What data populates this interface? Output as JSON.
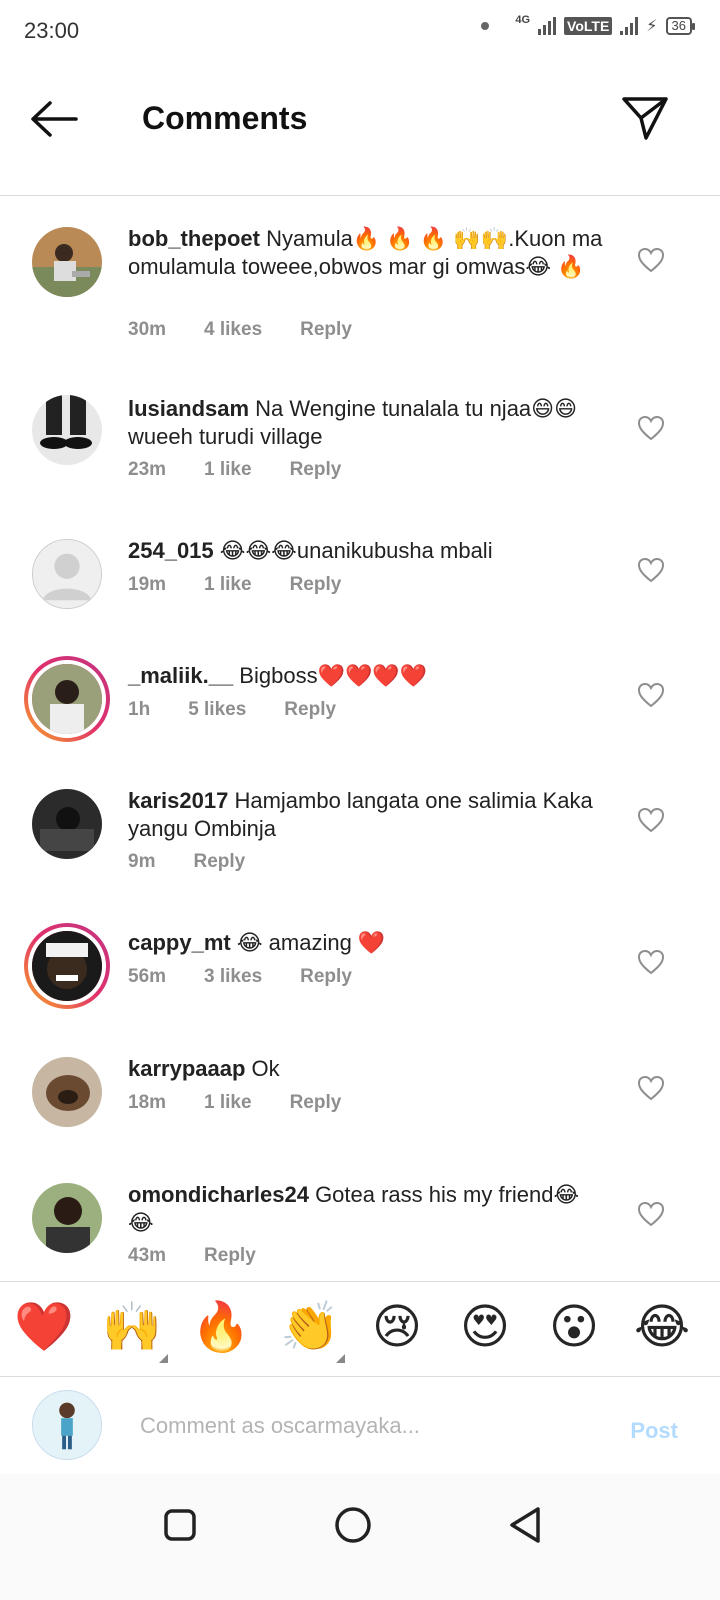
{
  "status_bar": {
    "time": "23:00",
    "network": "4G",
    "volte": "VoLTE",
    "battery": "36"
  },
  "header": {
    "title": "Comments"
  },
  "comments": [
    {
      "username": "bob_thepoet",
      "text": " Nyamula🔥 🔥 🔥 🙌🙌.Kuon ma omulamula toweee,obwos mar gi omwas😂 🔥",
      "time": "30m",
      "likes": "4 likes",
      "reply": "Reply"
    },
    {
      "username": "lusiandsam",
      "text": " Na Wengine tunalala tu njaa😄😄 wueeh turudi village",
      "time": "23m",
      "likes": "1 like",
      "reply": "Reply"
    },
    {
      "username": "254_015",
      "text": " 😂😂😂unanikubusha mbali",
      "time": "19m",
      "likes": "1 like",
      "reply": "Reply"
    },
    {
      "username": "_maliik.__",
      "text": " Bigboss❤️❤️❤️❤️",
      "time": "1h",
      "likes": "5 likes",
      "reply": "Reply"
    },
    {
      "username": "karis2017",
      "text": " Hamjambo langata one salimia Kaka yangu Ombinja",
      "time": "9m",
      "likes": "",
      "reply": "Reply"
    },
    {
      "username": "cappy_mt",
      "text": " 😂 amazing ❤️",
      "time": "56m",
      "likes": "3 likes",
      "reply": "Reply"
    },
    {
      "username": "karrypaaap",
      "text": " Ok",
      "time": "18m",
      "likes": "1 like",
      "reply": "Reply"
    },
    {
      "username": "omondicharles24",
      "text": " Gotea rass his my friend😂 😂",
      "time": "43m",
      "likes": "",
      "reply": "Reply"
    }
  ],
  "emoji_bar": [
    "❤️",
    "🙌",
    "🔥",
    "👏",
    "😢",
    "😍",
    "😮",
    "😂"
  ],
  "composer": {
    "placeholder": "Comment as oscarmayaka...",
    "post_label": "Post"
  },
  "icons": {
    "back": "arrow-left-icon",
    "send": "paper-plane-icon",
    "heart": "heart-outline-icon",
    "nav": [
      "square-icon",
      "circle-icon",
      "triangle-back-icon"
    ]
  },
  "colors": {
    "post_disabled": "#b3dbff",
    "meta_gray": "#8e8e8e",
    "divider": "#dbdbdb"
  }
}
